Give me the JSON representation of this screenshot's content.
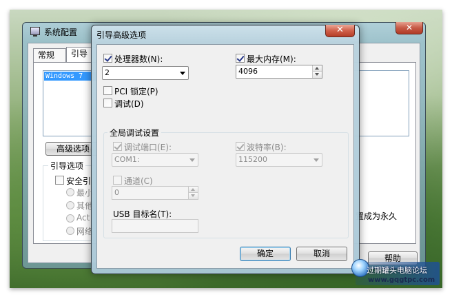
{
  "background_window": {
    "title": "系统配置",
    "close_glyph": "✕",
    "tabs": [
      "常规",
      "引导"
    ],
    "os_list_item": "Windows 7",
    "advanced_button": "高级选项",
    "boot_options_label": "引导选项",
    "safe_boot_label": "安全引",
    "radio_options": [
      "最小",
      "其他",
      "Act",
      "网络"
    ],
    "permanent_text": "置成为永久",
    "help_button": "帮助"
  },
  "dialog": {
    "title": "引导高级选项",
    "close_glyph": "✕",
    "num_processors": {
      "label": "处理器数(N):",
      "checked": true,
      "value": "2"
    },
    "max_memory": {
      "label": "最大内存(M):",
      "checked": true,
      "value": "4096"
    },
    "pci_lock": {
      "label": "PCI 锁定(P)",
      "checked": false
    },
    "debug": {
      "label": "调试(D)",
      "checked": false
    },
    "global_debug": {
      "group_label": "全局调试设置",
      "debug_port": {
        "label": "调试端口(E):",
        "checked": true,
        "value": "COM1:"
      },
      "baud_rate": {
        "label": "波特率(B):",
        "checked": true,
        "value": "115200"
      },
      "channel": {
        "label": "通道(C)",
        "checked": false,
        "value": "0"
      },
      "usb_target": {
        "label": "USB 目标名(T):",
        "value": ""
      }
    },
    "ok_button": "确定",
    "cancel_button": "取消"
  },
  "watermark": {
    "title": "过期罐头电脑论坛",
    "url": "www.gqgtpc.com"
  }
}
